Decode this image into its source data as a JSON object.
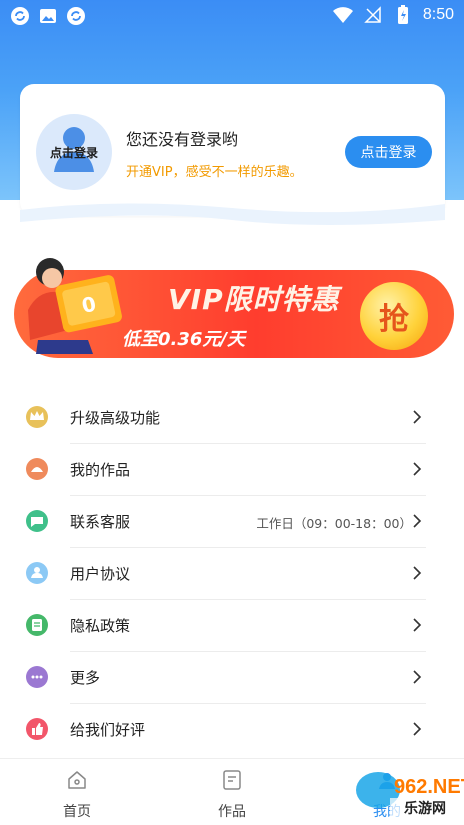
{
  "status_bar": {
    "time": "8:50"
  },
  "profile": {
    "avatar_label": "点击登录",
    "title": "您还没有登录哟",
    "subtitle": "开通VIP，感受不一样的乐趣。",
    "login_button": "点击登录"
  },
  "banner": {
    "title": "VIP限时特惠",
    "subtitle": "低至0.36元/天",
    "grab": "抢"
  },
  "menu": [
    {
      "label": "升级高级功能",
      "value": "",
      "icon": "crown-icon",
      "color": "#e8c15a"
    },
    {
      "label": "我的作品",
      "value": "",
      "icon": "works-icon",
      "color": "#ef8a5c"
    },
    {
      "label": "联系客服",
      "value": "工作日（09：00-18：00）",
      "icon": "chat-icon",
      "color": "#3fc08a"
    },
    {
      "label": "用户协议",
      "value": "",
      "icon": "user-agreement-icon",
      "color": "#8cc9f5"
    },
    {
      "label": "隐私政策",
      "value": "",
      "icon": "privacy-icon",
      "color": "#45b86a"
    },
    {
      "label": "更多",
      "value": "",
      "icon": "more-icon",
      "color": "#9b78d2"
    },
    {
      "label": "给我们好评",
      "value": "",
      "icon": "thumbs-up-icon",
      "color": "#f2566a"
    }
  ],
  "bottom_nav": [
    {
      "label": "首页",
      "icon": "home-icon"
    },
    {
      "label": "作品",
      "icon": "works-tab-icon"
    },
    {
      "label": "我的",
      "icon": "profile-tab-icon"
    }
  ],
  "watermark": {
    "text": "962.NET",
    "sub": "乐游网"
  }
}
